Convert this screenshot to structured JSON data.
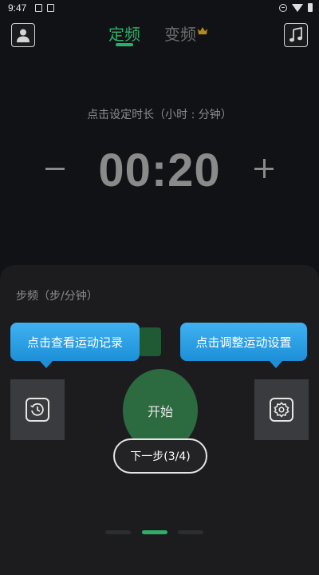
{
  "status_bar": {
    "time": "9:47"
  },
  "tabs": [
    {
      "label": "定频",
      "active": true
    },
    {
      "label": "变频",
      "active": false
    }
  ],
  "timer": {
    "hint": "点击设定时长（小时 : 分钟）",
    "value": "00:20",
    "decrement_symbol": "−",
    "increment_symbol": "+"
  },
  "cadence": {
    "label": "步频（步/分钟）"
  },
  "tooltips": {
    "history": "点击查看运动记录",
    "settings": "点击调整运动设置"
  },
  "start_button": {
    "label": "开始"
  },
  "next_button": {
    "label": "下一步(3/4)"
  },
  "pager": {
    "total": 3,
    "active_index": 1
  },
  "icons": {
    "profile": "user-icon",
    "music": "music-note-icon",
    "history": "history-icon",
    "settings": "gear-icon",
    "vip": "crown-icon"
  },
  "colors": {
    "accent_green": "#2fae6a",
    "tooltip_blue": "#2aa0e6",
    "background": "#111215"
  }
}
